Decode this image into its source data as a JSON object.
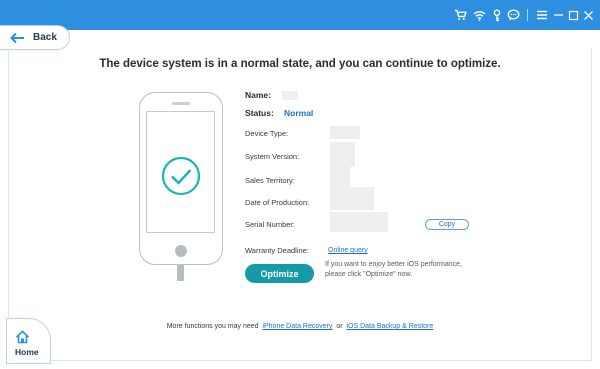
{
  "titlebar": {
    "icons": [
      "cart-icon",
      "wifi-icon",
      "key-icon",
      "chat-icon",
      "menu-icon",
      "minimize-icon",
      "maximize-icon",
      "close-icon"
    ]
  },
  "nav": {
    "back_label": "Back",
    "home_label": "Home"
  },
  "headline": "The device system is in a normal state, and you can continue to optimize.",
  "device": {
    "name_label": "Name:",
    "status_label": "Status:",
    "status_value": "Normal",
    "device_type_label": "Device Type:",
    "system_version_label": "System Version:",
    "sales_territory_label": "Sales Territory:",
    "date_of_production_label": "Date of Production:",
    "serial_number_label": "Serial Number:",
    "copy_label": "Copy",
    "warranty_label": "Warranty Deadline:",
    "online_query_label": "Online query"
  },
  "optimize": {
    "button_label": "Optimize",
    "hint": "If you want to enjoy better iOS performance, please click \"Optimize\" now."
  },
  "footer": {
    "prefix": "More functions you may need",
    "link1": "iPhone Data Recovery",
    "or": "or",
    "link2": "iOS Data Backup & Restore"
  },
  "colors": {
    "titlebar": "#2e8fe0",
    "accent_teal": "#169aa8",
    "link_blue": "#1e6fd0"
  }
}
